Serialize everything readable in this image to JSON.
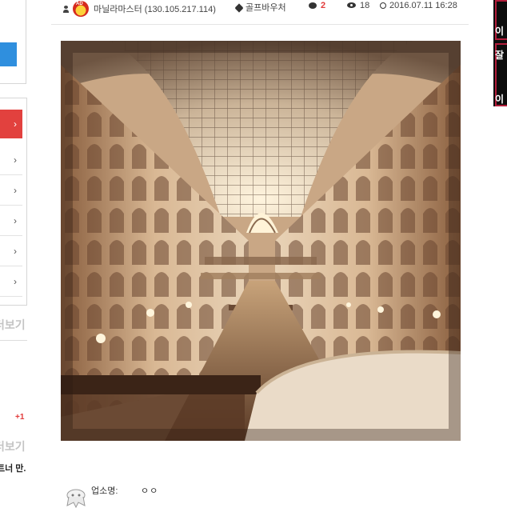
{
  "post_meta": {
    "author": "마닐라마스터 (130.105.217.114)",
    "author_avatar_text": "AD",
    "category": "골프바우처",
    "comment_count": "2",
    "views": "18",
    "datetime": "2016.07.11 16:28"
  },
  "sidebar": {
    "chevron": "›",
    "more_label": "더보기",
    "vote_plus": "+1",
    "truncated_text": "트너 만."
  },
  "uploader": {
    "label": "업소명:",
    "value": "ㅇㅇ"
  },
  "right_banner": {
    "chars": [
      "이",
      "잘",
      "이"
    ]
  },
  "colors": {
    "accent_red": "#e2413e",
    "accent_blue": "#2f8fde",
    "comment_count": "#e23b3b"
  }
}
